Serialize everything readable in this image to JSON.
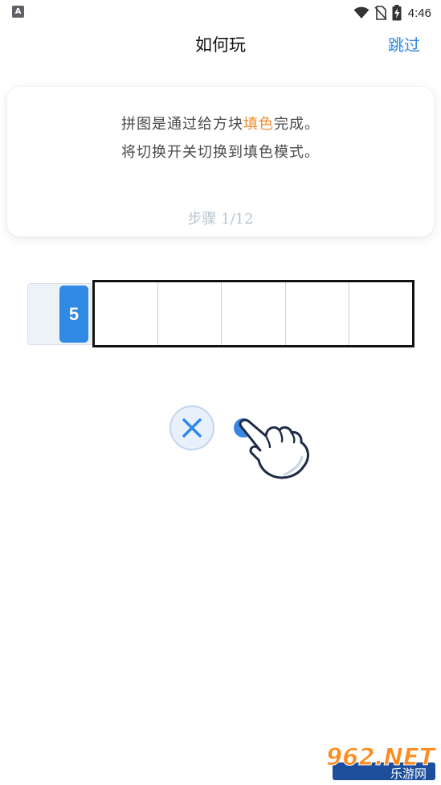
{
  "status_bar": {
    "app_icon_letter": "A",
    "time": "4:46"
  },
  "header": {
    "title": "如何玩",
    "skip_label": "跳过"
  },
  "tutorial": {
    "line1_prefix": "拼图是通过给方块",
    "line1_highlight": "填色",
    "line1_suffix": "完成。",
    "line2": "将切换开关切换到填色模式。",
    "step": "步骤 1/12",
    "highlight_color": "#f08c2b"
  },
  "puzzle": {
    "row_clue": "5",
    "cell_count": 5,
    "accent_color": "#3189e6"
  },
  "controls": {
    "clear_icon": "close-icon",
    "hand_icon": "pointing-hand-icon"
  },
  "watermark": {
    "logo_text": "962.NET",
    "sub_text": "乐游网"
  }
}
